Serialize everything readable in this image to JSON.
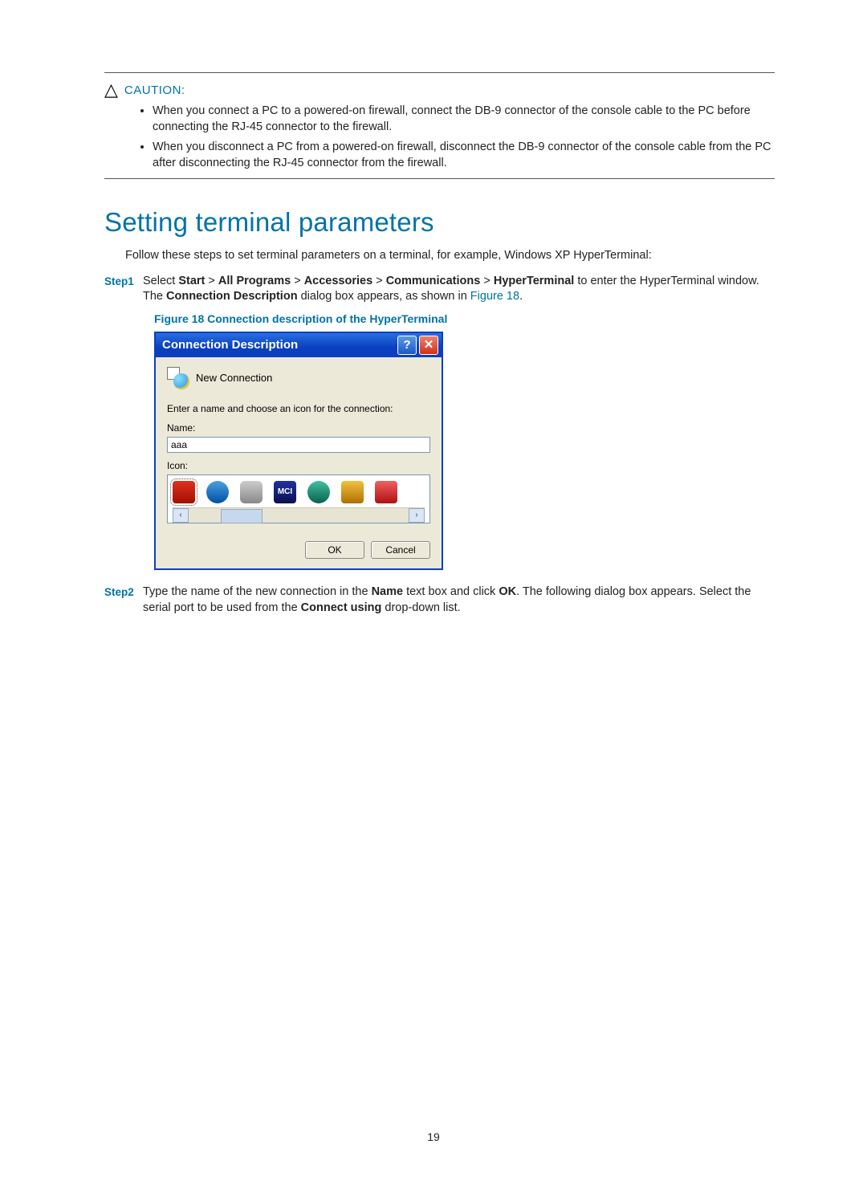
{
  "caution": {
    "label": "CAUTION:",
    "items": [
      "When you connect a PC to a powered-on firewall, connect the DB-9 connector of the console cable to the PC before connecting the RJ-45 connector to the firewall.",
      "When you disconnect a PC from a powered-on firewall, disconnect the DB-9 connector of the console cable from the PC after disconnecting the RJ-45 connector from the firewall."
    ]
  },
  "heading": "Setting terminal parameters",
  "intro": "Follow these steps to set terminal parameters on a terminal, for example, Windows XP HyperTerminal:",
  "step1": {
    "label": "Step1",
    "pre": "Select ",
    "b1": "Start",
    "sep": " > ",
    "b2": "All Programs",
    "b3": "Accessories",
    "b4": "Communications",
    "b5": "HyperTerminal",
    "post1": " to enter the HyperTerminal window. The ",
    "b6": "Connection Description",
    "post2": " dialog box appears, as shown in ",
    "link": "Figure 18",
    "period": "."
  },
  "figcap": "Figure 18 Connection description of the HyperTerminal",
  "dialog": {
    "title": "Connection Description",
    "help_glyph": "?",
    "close_glyph": "✕",
    "new_conn": "New Connection",
    "prompt": "Enter a name and choose an icon for the connection:",
    "name_label": "Name:",
    "name_value": "aaa",
    "icon_label": "Icon:",
    "mci_label": "MCI",
    "scroll_left": "‹",
    "scroll_right": "›",
    "ok": "OK",
    "cancel": "Cancel"
  },
  "step2": {
    "label": "Step2",
    "pre": "Type the name of the new connection in the ",
    "b1": "Name",
    "mid1": " text box and click ",
    "b2": "OK",
    "mid2": ". The following dialog box appears. Select the serial port to be used from the ",
    "b3": "Connect using",
    "post": " drop-down list."
  },
  "page_number": "19"
}
